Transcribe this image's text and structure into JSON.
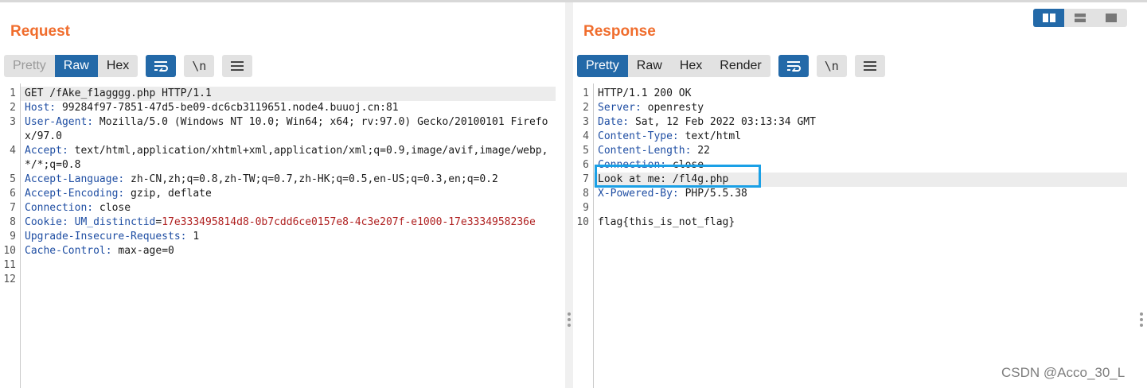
{
  "request": {
    "title": "Request",
    "tabs": [
      {
        "label": "Pretty",
        "state": "disabled"
      },
      {
        "label": "Raw",
        "state": "selected"
      },
      {
        "label": "Hex",
        "state": "normal"
      }
    ],
    "newline_toggle": "\\n",
    "lines": [
      {
        "n": "1",
        "text": "GET /fAke_f1agggg.php HTTP/1.1"
      },
      {
        "n": "2",
        "key": "Host:",
        "val": " 99284f97-7851-47d5-be09-dc6cb3119651.node4.buuoj.cn:81"
      },
      {
        "n": "3",
        "key": "User-Agent:",
        "val": " Mozilla/5.0 (Windows NT 10.0; Win64; x64; rv:97.0) Gecko/20100101 Firefox/97.0"
      },
      {
        "n": "4",
        "key": "Accept:",
        "val": " text/html,application/xhtml+xml,application/xml;q=0.9,image/avif,image/webp,*/*;q=0.8"
      },
      {
        "n": "5",
        "key": "Accept-Language:",
        "val": " zh-CN,zh;q=0.8,zh-TW;q=0.7,zh-HK;q=0.5,en-US;q=0.3,en;q=0.2"
      },
      {
        "n": "6",
        "key": "Accept-Encoding:",
        "val": " gzip, deflate"
      },
      {
        "n": "7",
        "key": "Connection:",
        "val": " close"
      },
      {
        "n": "8",
        "key": "Cookie:",
        "ckey": " UM_distinctid",
        "eq": "=",
        "cval": "17e333495814d8-0b7cdd6ce0157e8-4c3e207f-e1000-17e3334958236e"
      },
      {
        "n": "9",
        "key": "Upgrade-Insecure-Requests:",
        "val": " 1"
      },
      {
        "n": "10",
        "key": "Cache-Control:",
        "val": " max-age=0"
      },
      {
        "n": "11",
        "text": ""
      },
      {
        "n": "12",
        "text": ""
      }
    ]
  },
  "response": {
    "title": "Response",
    "tabs": [
      {
        "label": "Pretty",
        "state": "selected"
      },
      {
        "label": "Raw",
        "state": "normal"
      },
      {
        "label": "Hex",
        "state": "normal"
      },
      {
        "label": "Render",
        "state": "normal"
      }
    ],
    "newline_toggle": "\\n",
    "lines": [
      {
        "n": "1",
        "text": "HTTP/1.1 200 OK"
      },
      {
        "n": "2",
        "key": "Server:",
        "val": " openresty"
      },
      {
        "n": "3",
        "key": "Date:",
        "val": " Sat, 12 Feb 2022 03:13:34 GMT"
      },
      {
        "n": "4",
        "key": "Content-Type:",
        "val": " text/html"
      },
      {
        "n": "5",
        "key": "Content-Length:",
        "val": " 22"
      },
      {
        "n": "6",
        "key": "Connection:",
        "val": " close"
      },
      {
        "n": "7",
        "text": "Look at me: /fl4g.php"
      },
      {
        "n": "8",
        "key": "X-Powered-By:",
        "val": " PHP/5.5.38"
      },
      {
        "n": "9",
        "text": ""
      },
      {
        "n": "10",
        "text": "flag{this_is_not_flag}"
      }
    ]
  },
  "view_layout": {
    "options": [
      "side-by-side-icon",
      "top-bottom-icon",
      "single-pane-icon"
    ],
    "selected": "side-by-side-icon"
  },
  "colors": {
    "title": "#f06d2d",
    "selected_tab": "#2369a8",
    "header_key": "#1f4ea3",
    "cookie_value": "#b02121",
    "highlight_box": "#1aa0e6"
  },
  "watermark": "CSDN @Acco_30_L"
}
